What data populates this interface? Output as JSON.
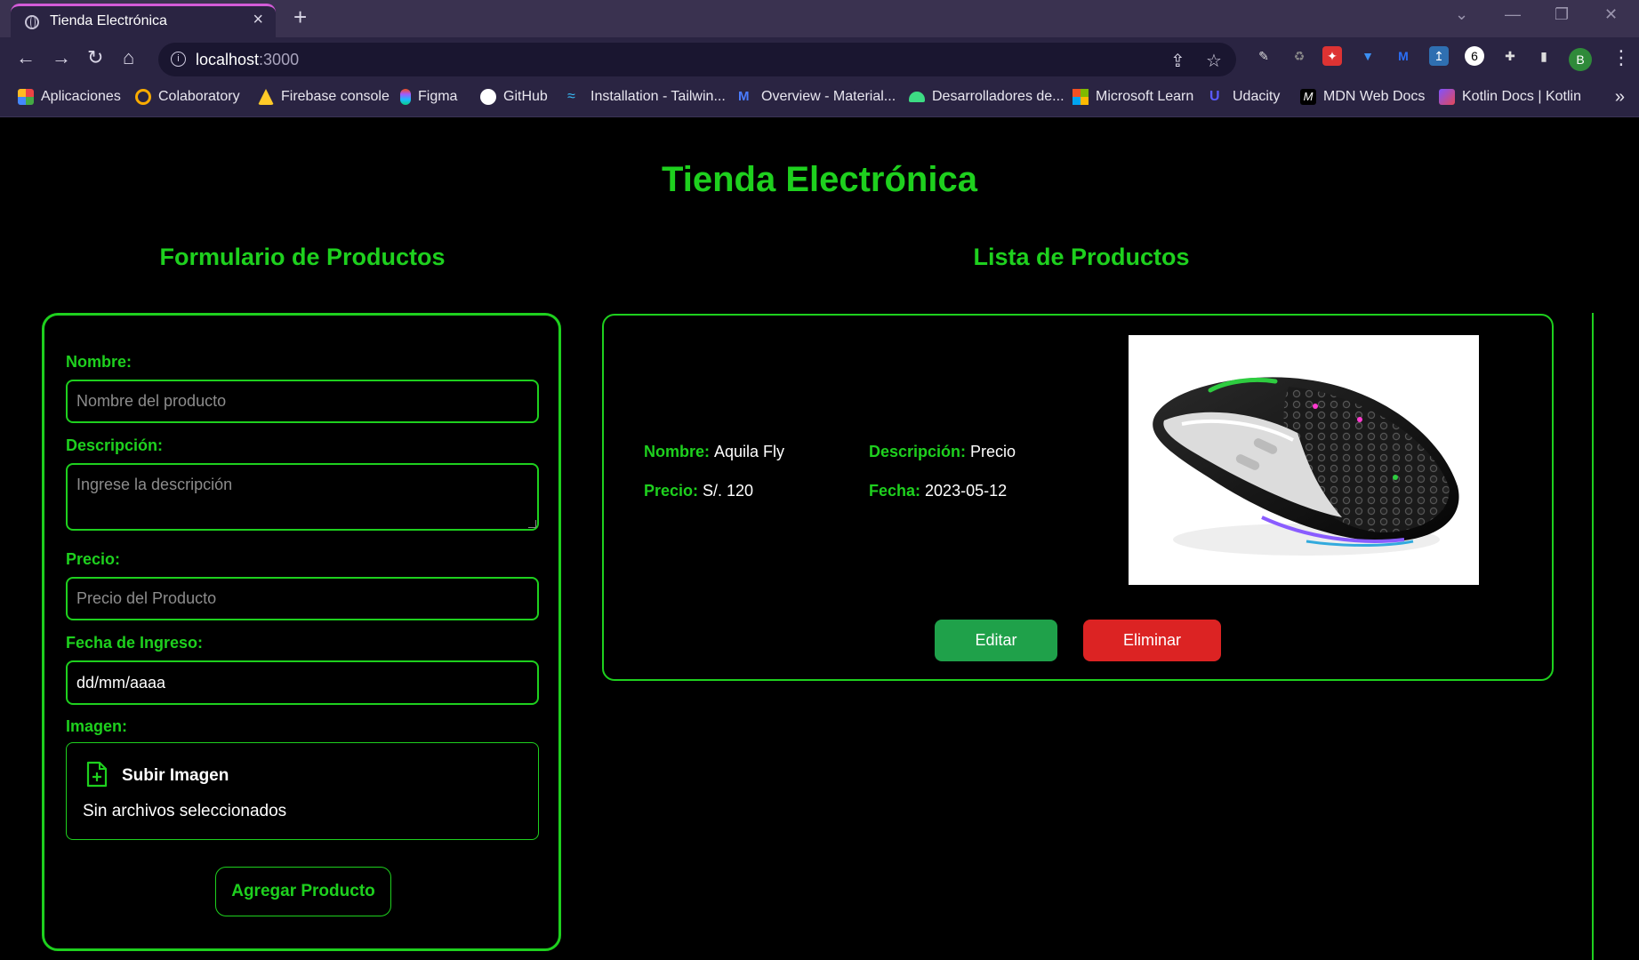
{
  "browser": {
    "tab_title": "Tienda Electrónica",
    "url_host": "localhost",
    "url_port": ":3000",
    "bookmarks": [
      {
        "label": "Aplicaciones",
        "icon": "apps-grid-icon"
      },
      {
        "label": "Colaboratory",
        "icon": "colab-icon"
      },
      {
        "label": "Firebase console",
        "icon": "firebase-icon"
      },
      {
        "label": "Figma",
        "icon": "figma-icon"
      },
      {
        "label": "GitHub",
        "icon": "github-icon"
      },
      {
        "label": "Installation - Tailwin...",
        "icon": "tailwind-icon"
      },
      {
        "label": "Overview - Material...",
        "icon": "material-icon"
      },
      {
        "label": "Desarrolladores de...",
        "icon": "android-icon"
      },
      {
        "label": "Microsoft Learn",
        "icon": "microsoft-icon"
      },
      {
        "label": "Udacity",
        "icon": "udacity-icon"
      },
      {
        "label": "MDN Web Docs",
        "icon": "mdn-icon"
      },
      {
        "label": "Kotlin Docs | Kotlin",
        "icon": "kotlin-icon"
      }
    ],
    "profile_initial": "B"
  },
  "page": {
    "title": "Tienda Electrónica",
    "form_title": "Formulario de Productos",
    "list_title": "Lista de Productos"
  },
  "form": {
    "name_label": "Nombre:",
    "name_placeholder": "Nombre del producto",
    "desc_label": "Descripción:",
    "desc_placeholder": "Ingrese la descripción",
    "price_label": "Precio:",
    "price_placeholder": "Precio del Producto",
    "date_label": "Fecha de Ingreso:",
    "date_value": "dd/mm/aaaa",
    "image_label": "Imagen:",
    "upload_label": "Subir Imagen",
    "upload_status": "Sin archivos seleccionados",
    "submit_label": "Agregar Producto"
  },
  "product": {
    "name_key": "Nombre:",
    "name_value": "Aquila Fly",
    "desc_key": "Descripción:",
    "desc_value": "Precio",
    "price_key": "Precio:",
    "price_value": "S/. 120",
    "date_key": "Fecha:",
    "date_value": "2023-05-12",
    "edit_label": "Editar",
    "delete_label": "Eliminar"
  },
  "colors": {
    "accent": "#1ed01e",
    "edit": "#1fa14a",
    "delete": "#dc2323"
  }
}
